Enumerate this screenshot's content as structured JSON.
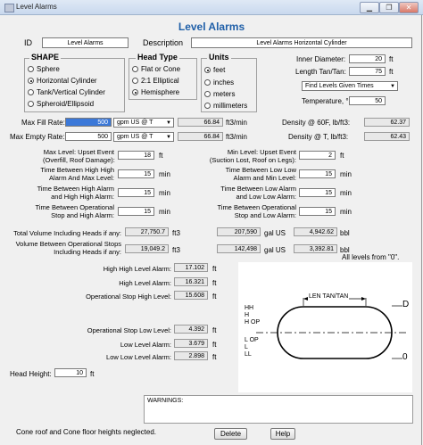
{
  "window": {
    "title": "Level Alarms",
    "heading": "Level Alarms"
  },
  "id": {
    "label": "ID",
    "value": "Level Alarms"
  },
  "description": {
    "label": "Description",
    "value": "Level Alarms Horizontal Cylinder"
  },
  "shape": {
    "title": "SHAPE",
    "options": [
      "Sphere",
      "Horizontal Cylinder",
      "Tank/Vertical Cylinder",
      "Spheroid/Ellipsoid"
    ],
    "selected": 1
  },
  "head_type": {
    "title": "Head Type",
    "options": [
      "Flat or Cone",
      "2:1 Elliptical",
      "Hemisphere"
    ],
    "selected": 2
  },
  "units": {
    "title": "Units",
    "options": [
      "feet",
      "inches",
      "meters",
      "millimeters"
    ],
    "selected": 0
  },
  "inner_diameter": {
    "label": "Inner Diameter:",
    "value": "20",
    "unit": "ft"
  },
  "length_tan": {
    "label": "Length Tan/Tan:",
    "value": "75",
    "unit": "ft"
  },
  "calc_mode": {
    "value": "Find Levels Given Times"
  },
  "temperature": {
    "label": "Temperature, °F:",
    "value": "50"
  },
  "max_fill": {
    "label": "Max Fill Rate:",
    "value": "500",
    "unit_select": "gpm US @ T",
    "converted": "66.84",
    "conv_unit": "ft3/min"
  },
  "max_empty": {
    "label": "Max Empty Rate:",
    "value": "500",
    "unit_select": "gpm US @ T",
    "converted": "66.84",
    "conv_unit": "ft3/min"
  },
  "density_60": {
    "label": "Density @ 60F, lb/ft3:",
    "value": "62.37"
  },
  "density_t": {
    "label": "Density @ T, lb/ft3:",
    "value": "62.43"
  },
  "max_level": {
    "label1": "Max Level: Upset Event",
    "label2": "(Overfill, Roof Damage):",
    "value": "18",
    "unit": "ft"
  },
  "min_level": {
    "label1": "Min Level: Upset Event",
    "label2": "(Suction Lost, Roof on Legs):",
    "value": "2",
    "unit": "ft"
  },
  "t_hh_max": {
    "label1": "Time Between High High",
    "label2": "Alarm And Max Level:",
    "value": "15",
    "unit": "min"
  },
  "t_ll_min": {
    "label1": "Time Between Low Low",
    "label2": "Alarm and Min Level:",
    "value": "15",
    "unit": "min"
  },
  "t_h_hh": {
    "label1": "Time Between High Alarm",
    "label2": "and High High Alarm:",
    "value": "15",
    "unit": "min"
  },
  "t_l_ll": {
    "label1": "Time Between Low Alarm",
    "label2": "and Low Low Alarm:",
    "value": "15",
    "unit": "min"
  },
  "t_op_h": {
    "label1": "Time Between Operational",
    "label2": "Stop and High Alarm:",
    "value": "15",
    "unit": "min"
  },
  "t_op_l": {
    "label1": "Time Between Operational",
    "label2": "Stop and Low Alarm:",
    "value": "15",
    "unit": "min"
  },
  "total_volume": {
    "label": "Total Volume Including Heads if any:",
    "ft3": "27,750.7",
    "gal": "207,590",
    "bbl": "4,942.62"
  },
  "op_volume": {
    "label1": "Volume Between Operational Stops",
    "label2": "Including Heads if any:",
    "ft3": "19,049.2",
    "gal": "142,498",
    "bbl": "3,392.81"
  },
  "vol_units": {
    "ft3": "ft3",
    "gal": "gal US",
    "bbl": "bbl"
  },
  "levels_note": "All levels from \"0\".",
  "alarms": {
    "hhl": {
      "label": "High High Level Alarm:",
      "value": "17.102",
      "unit": "ft"
    },
    "hl": {
      "label": "High Level Alarm:",
      "value": "16.321",
      "unit": "ft"
    },
    "ohl": {
      "label": "Operational Stop High Level:",
      "value": "15.608",
      "unit": "ft"
    },
    "oll": {
      "label": "Operational Stop Low Level:",
      "value": "4.392",
      "unit": "ft"
    },
    "ll": {
      "label": "Low Level Alarm:",
      "value": "3.679",
      "unit": "ft"
    },
    "lll": {
      "label": "Low Low Level Alarm:",
      "value": "2.898",
      "unit": "ft"
    }
  },
  "head_height": {
    "label": "Head Height:",
    "value": "10",
    "unit": "ft"
  },
  "diagram": {
    "len_label": "LEN TAN/TAN",
    "top_label": "D",
    "bottom_label": "0",
    "left_labels": [
      "HH",
      "H",
      "H OP",
      "L OP",
      "L",
      "LL"
    ]
  },
  "warnings": {
    "label": "WARNINGS:"
  },
  "footer_note": "Cone roof and Cone floor heights neglected.",
  "buttons": {
    "delete": "Delete",
    "help": "Help"
  }
}
